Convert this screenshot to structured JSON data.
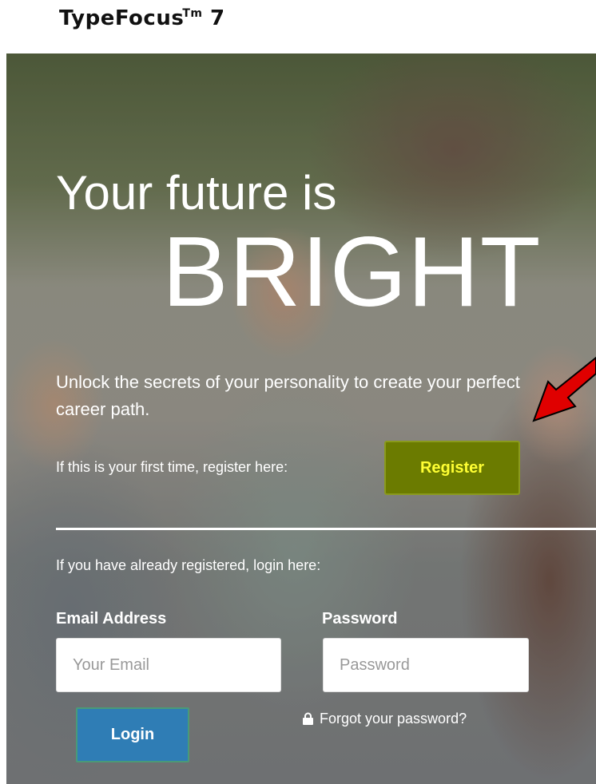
{
  "brand": {
    "name": "TypeFocus",
    "trademark": "Tm",
    "version": "7"
  },
  "hero": {
    "headline_line1": "Your future is",
    "headline_line2": "BRIGHT",
    "tagline": "Unlock the secrets of your personality to create your perfect career path."
  },
  "register": {
    "prompt": "If this is your first time, register here:",
    "button_label": "Register"
  },
  "login": {
    "prompt": "If you have already registered, login here:",
    "email_label": "Email Address",
    "email_placeholder": "Your Email",
    "password_label": "Password",
    "password_placeholder": "Password",
    "button_label": "Login",
    "forgot_label": "Forgot your password?"
  },
  "icons": {
    "forgot": "lock-icon",
    "annotation": "arrow-annotation"
  },
  "colors": {
    "register_bg": "#6b7b00",
    "register_text": "#ffff33",
    "login_bg": "#2f7db5",
    "arrow": "#e00000"
  }
}
